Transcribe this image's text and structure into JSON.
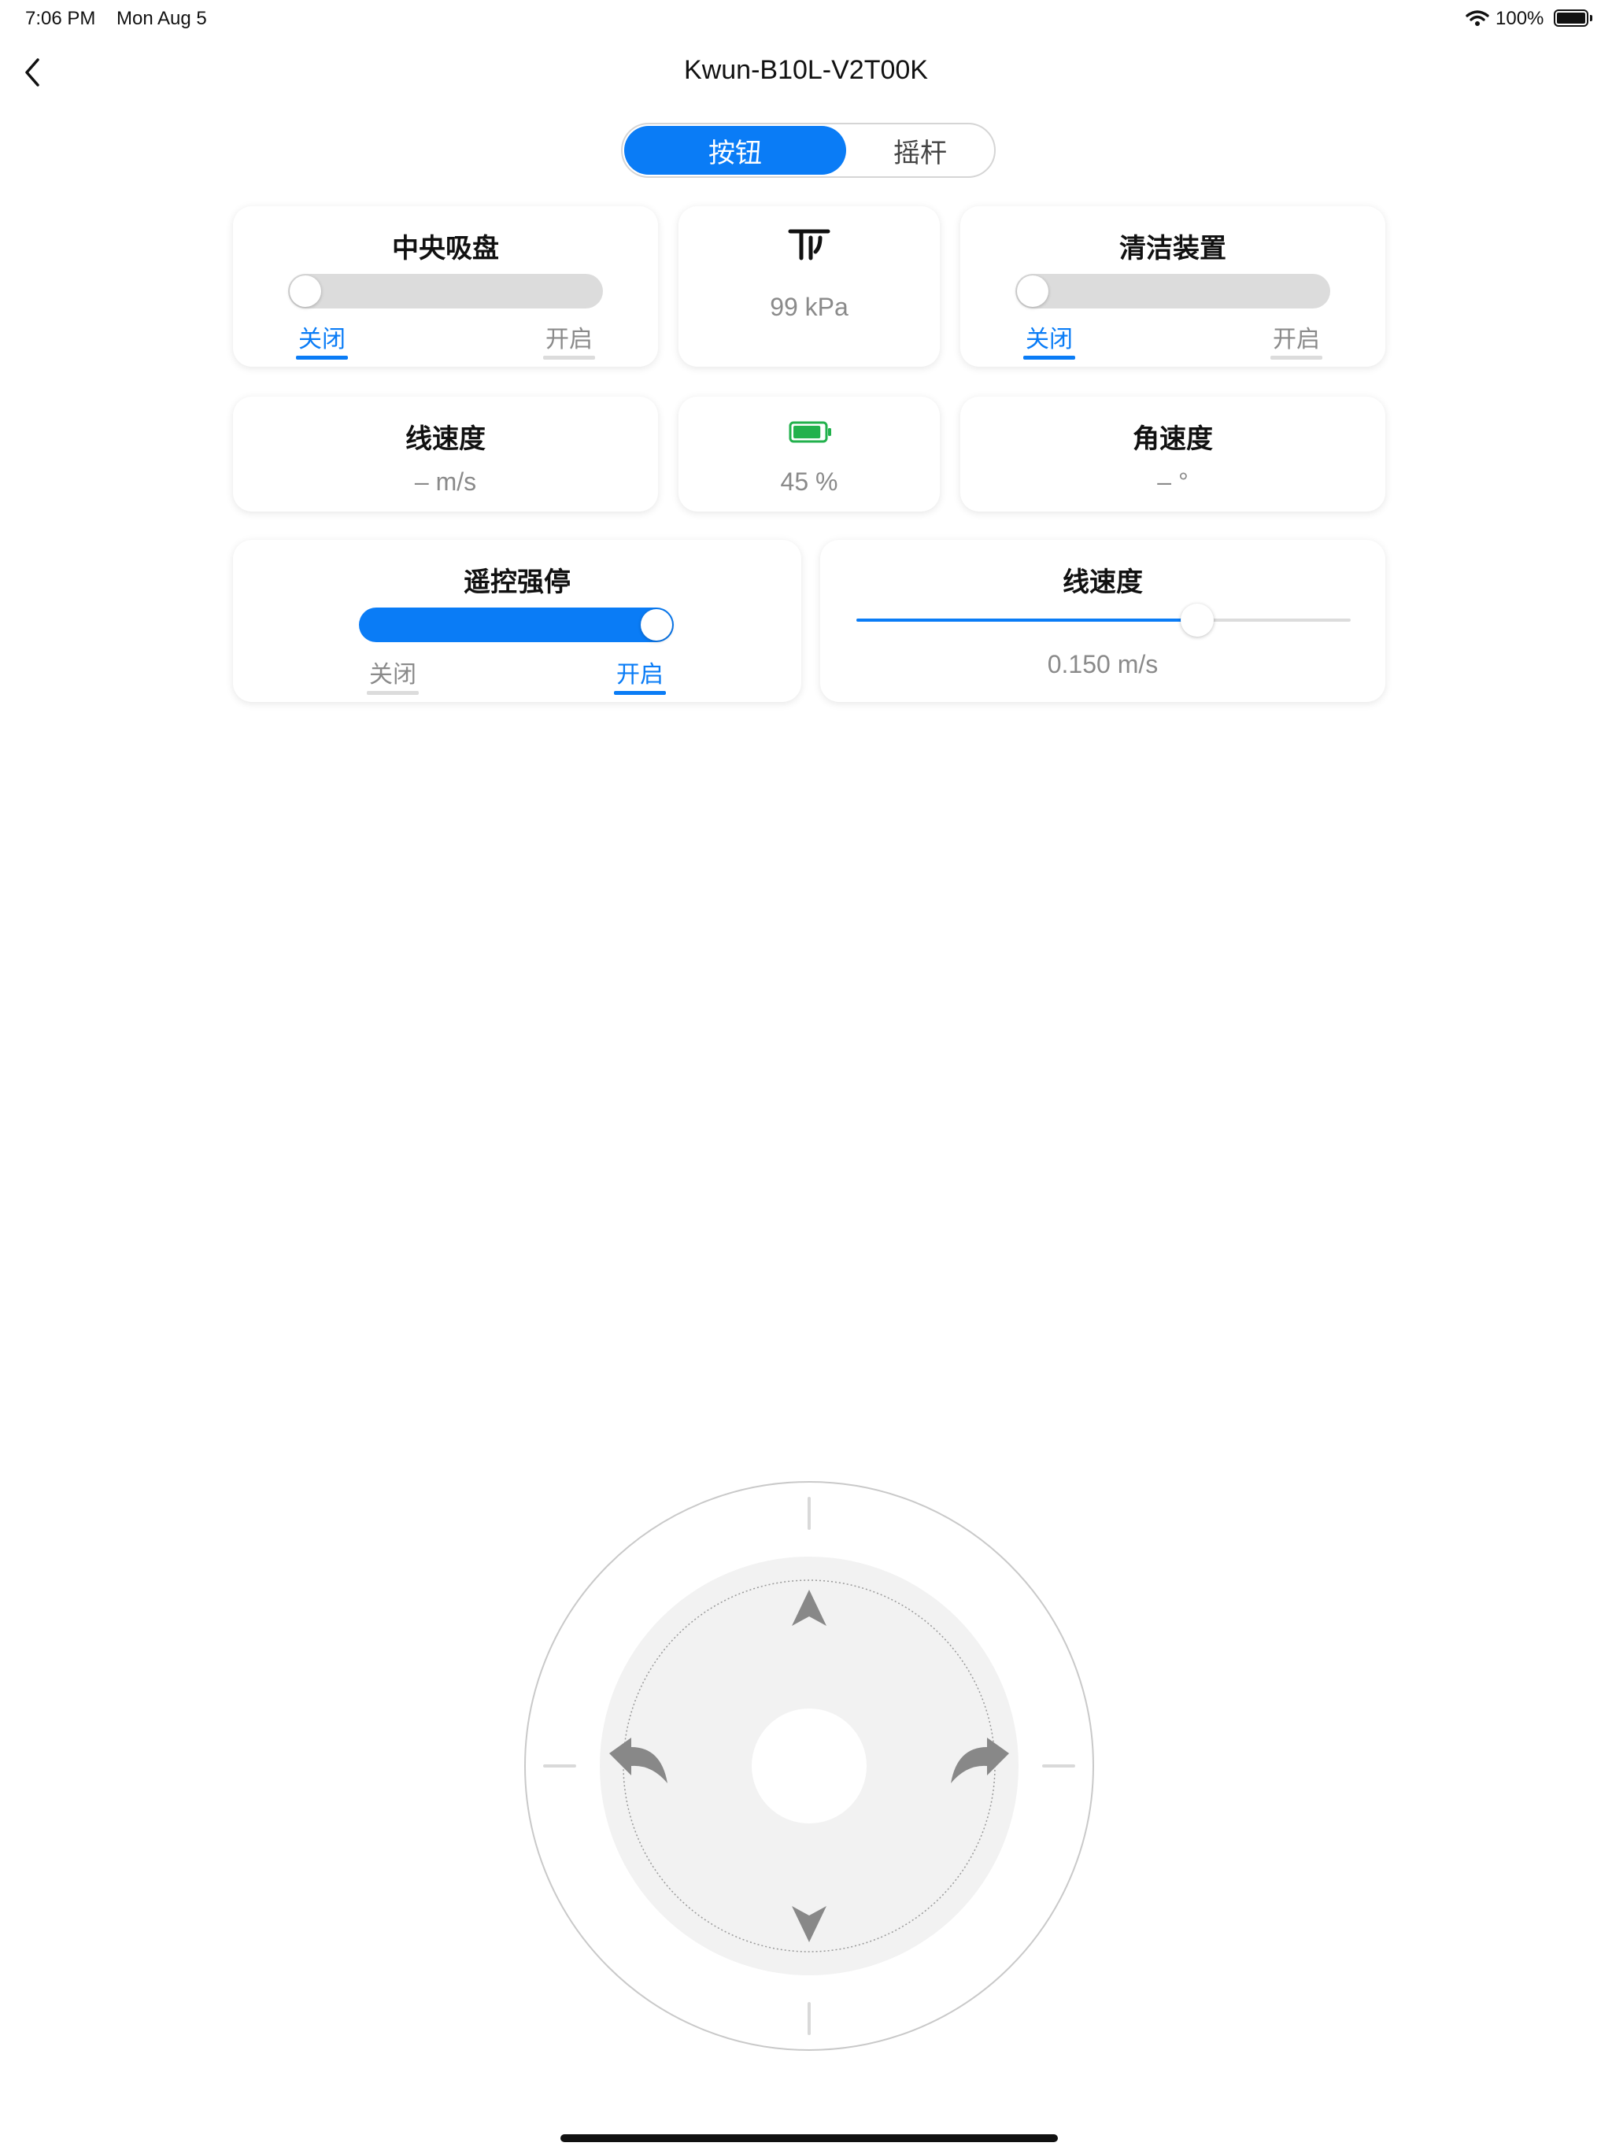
{
  "status_bar": {
    "time": "7:06 PM",
    "date": "Mon Aug 5",
    "battery": "100%"
  },
  "nav": {
    "title": "Kwun-B10L-V2T00K",
    "back_icon": "chevron-left-icon"
  },
  "mode_tabs": {
    "items": [
      "按钮",
      "摇杆"
    ],
    "selected": "按钮"
  },
  "cards": {
    "suction": {
      "title": "中央吸盘",
      "off_label": "关闭",
      "on_label": "开启",
      "state": "关闭"
    },
    "pressure": {
      "icon": "pressure-icon",
      "value": "99 kPa"
    },
    "cleaning": {
      "title": "清洁装置",
      "off_label": "关闭",
      "on_label": "开启",
      "state": "关闭"
    },
    "linear_speed": {
      "title": "线速度",
      "value": "– m/s"
    },
    "battery": {
      "icon": "battery-icon",
      "value": "45 %",
      "level": 0.45,
      "color": "#22b14c"
    },
    "angular_speed": {
      "title": "角速度",
      "value": "– °"
    },
    "remote_estop": {
      "title": "遥控强停",
      "off_label": "关闭",
      "on_label": "开启",
      "state": "开启"
    },
    "speed_slider": {
      "title": "线速度",
      "value": "0.150 m/s",
      "level": 0.69
    }
  },
  "joystick": {
    "controls": [
      "up-arrow-icon",
      "down-arrow-icon",
      "turn-left-icon",
      "turn-right-icon"
    ]
  },
  "colors": {
    "accent": "#0a7cf6",
    "track_off": "#dcdcdc",
    "muted_text": "#8a8a8a",
    "battery_green": "#22b14c"
  }
}
